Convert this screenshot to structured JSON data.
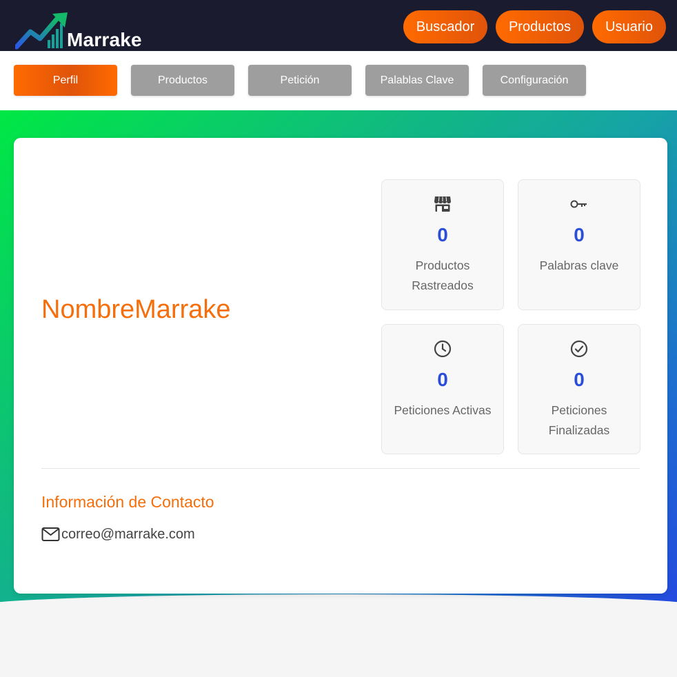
{
  "app": {
    "name": "Marrake"
  },
  "header_nav": [
    {
      "label": "Buscador"
    },
    {
      "label": "Productos"
    },
    {
      "label": "Usuario"
    }
  ],
  "tabs": [
    {
      "label": "Perfil",
      "active": true
    },
    {
      "label": "Productos",
      "active": false
    },
    {
      "label": "Petición",
      "active": false
    },
    {
      "label": "Palablas Clave",
      "active": false
    },
    {
      "label": "Configuración",
      "active": false
    }
  ],
  "profile": {
    "username": "NombreMarrake"
  },
  "stats": [
    {
      "icon": "store-icon",
      "value": "0",
      "label": "Productos Rastreados"
    },
    {
      "icon": "key-icon",
      "value": "0",
      "label": "Palabras clave"
    },
    {
      "icon": "clock-icon",
      "value": "0",
      "label": "Peticiones Activas"
    },
    {
      "icon": "check-circle-icon",
      "value": "0",
      "label": "Peticiones Finalizadas"
    }
  ],
  "contact": {
    "title": "Información de Contacto",
    "email": "correo@marrake.com",
    "email_icon": "mail-icon"
  },
  "colors": {
    "header_bg": "#1a1b2e",
    "accent_orange": "#f46f0c",
    "stat_number": "#2b4ed8",
    "tab_inactive": "#9e9e9e"
  }
}
